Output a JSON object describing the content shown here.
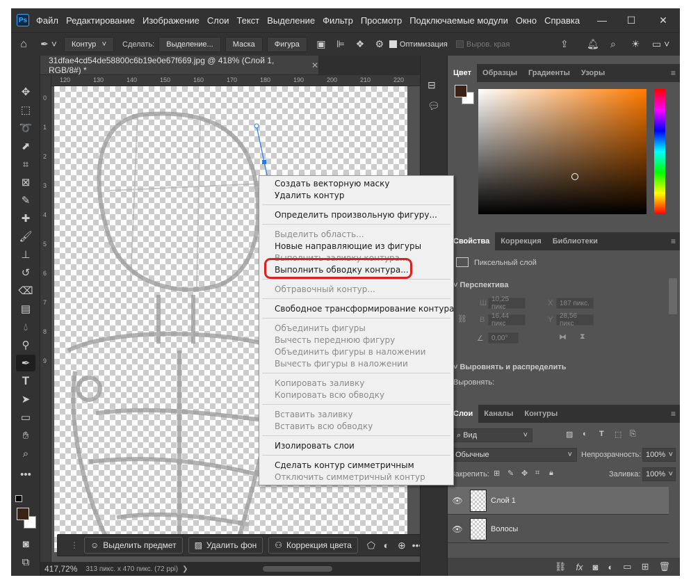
{
  "menu": {
    "logo": "Ps",
    "items": [
      "Файл",
      "Редактирование",
      "Изображение",
      "Слои",
      "Текст",
      "Выделение",
      "Фильтр",
      "Просмотр",
      "Подключаемые модули",
      "Окно",
      "Справка"
    ]
  },
  "options": {
    "mode_select": "Контур",
    "make_label": "Сделать:",
    "btn_selection": "Выделение...",
    "btn_mask": "Маска",
    "btn_shape": "Фигура",
    "optimization_label": "Оптимизация",
    "align_edges_label": "Выров. края"
  },
  "document": {
    "tab_title": "31dfae4cd54de58800c6b19e0e67f669.jpg @ 418% (Слой 1, RGB/8#) *",
    "ruler_h": [
      "120",
      "130",
      "140",
      "150",
      "160",
      "170",
      "180",
      "190",
      "200",
      "210",
      "220"
    ],
    "ruler_v": [
      "0",
      "1",
      "2",
      "3",
      "4",
      "5",
      "6",
      "7",
      "8",
      "9"
    ],
    "zoom": "417,72%",
    "doc_size": "313 пикс. x 470 пикс. (72 ppi)"
  },
  "context_bar": {
    "select_subject": "Выделить предмет",
    "remove_bg": "Удалить фон",
    "color_correction": "Коррекция цвета"
  },
  "context_menu": {
    "items": [
      {
        "label": "Создать векторную маску",
        "disabled": false
      },
      {
        "label": "Удалить контур",
        "disabled": false
      },
      {
        "label": "Определить произвольную фигуру...",
        "disabled": false
      },
      {
        "label": "Выделить область...",
        "disabled": true
      },
      {
        "label": "Новые направляющие из фигуры",
        "disabled": false
      },
      {
        "label": "Выполнить заливку контура...",
        "disabled": true
      },
      {
        "label": "Выполнить обводку контура...",
        "disabled": false
      },
      {
        "label": "Обтравочный контур...",
        "disabled": true
      },
      {
        "label": "Свободное трансформирование контура",
        "disabled": false
      },
      {
        "label": "Объединить фигуры",
        "disabled": true
      },
      {
        "label": "Вычесть переднюю фигуру",
        "disabled": true
      },
      {
        "label": "Объединить фигуры в наложении",
        "disabled": true
      },
      {
        "label": "Вычесть фигуры в наложении",
        "disabled": true
      },
      {
        "label": "Копировать заливку",
        "disabled": true
      },
      {
        "label": "Копировать всю обводку",
        "disabled": true
      },
      {
        "label": "Вставить заливку",
        "disabled": true
      },
      {
        "label": "Вставить всю обводку",
        "disabled": true
      },
      {
        "label": "Изолировать слои",
        "disabled": false
      },
      {
        "label": "Сделать контур симметричным",
        "disabled": false
      },
      {
        "label": "Отключить симметричный контур",
        "disabled": true
      }
    ]
  },
  "color_panel": {
    "tabs": [
      "Цвет",
      "Образцы",
      "Градиенты",
      "Узоры"
    ],
    "foreground": "#3a2314",
    "hue_color": "#ff7a00"
  },
  "properties_panel": {
    "tabs": [
      "Свойства",
      "Коррекция",
      "Библиотеки"
    ],
    "layer_type": "Пиксельный слой",
    "perspective_title": "Перспектива",
    "w_label": "Ш",
    "w_value": "10,25 пикс",
    "x_label": "X",
    "x_value": "187 пикс.",
    "h_label": "В",
    "h_value": "16,44 пикс",
    "y_label": "Y",
    "y_value": "28,56 пикс",
    "angle_value": "0,00°",
    "align_title": "Выровнять и распределить",
    "align_label": "Выровнять:"
  },
  "layers_panel": {
    "tabs": [
      "Слои",
      "Каналы",
      "Контуры"
    ],
    "filter_kind": "Вид",
    "blend_mode": "Обычные",
    "opacity_label": "Непрозрачность:",
    "opacity_value": "100%",
    "lock_label": "Закрепить:",
    "fill_label": "Заливка:",
    "fill_value": "100%",
    "layers": [
      {
        "name": "Слой 1",
        "selected": true
      },
      {
        "name": "Волосы",
        "selected": false
      }
    ]
  }
}
